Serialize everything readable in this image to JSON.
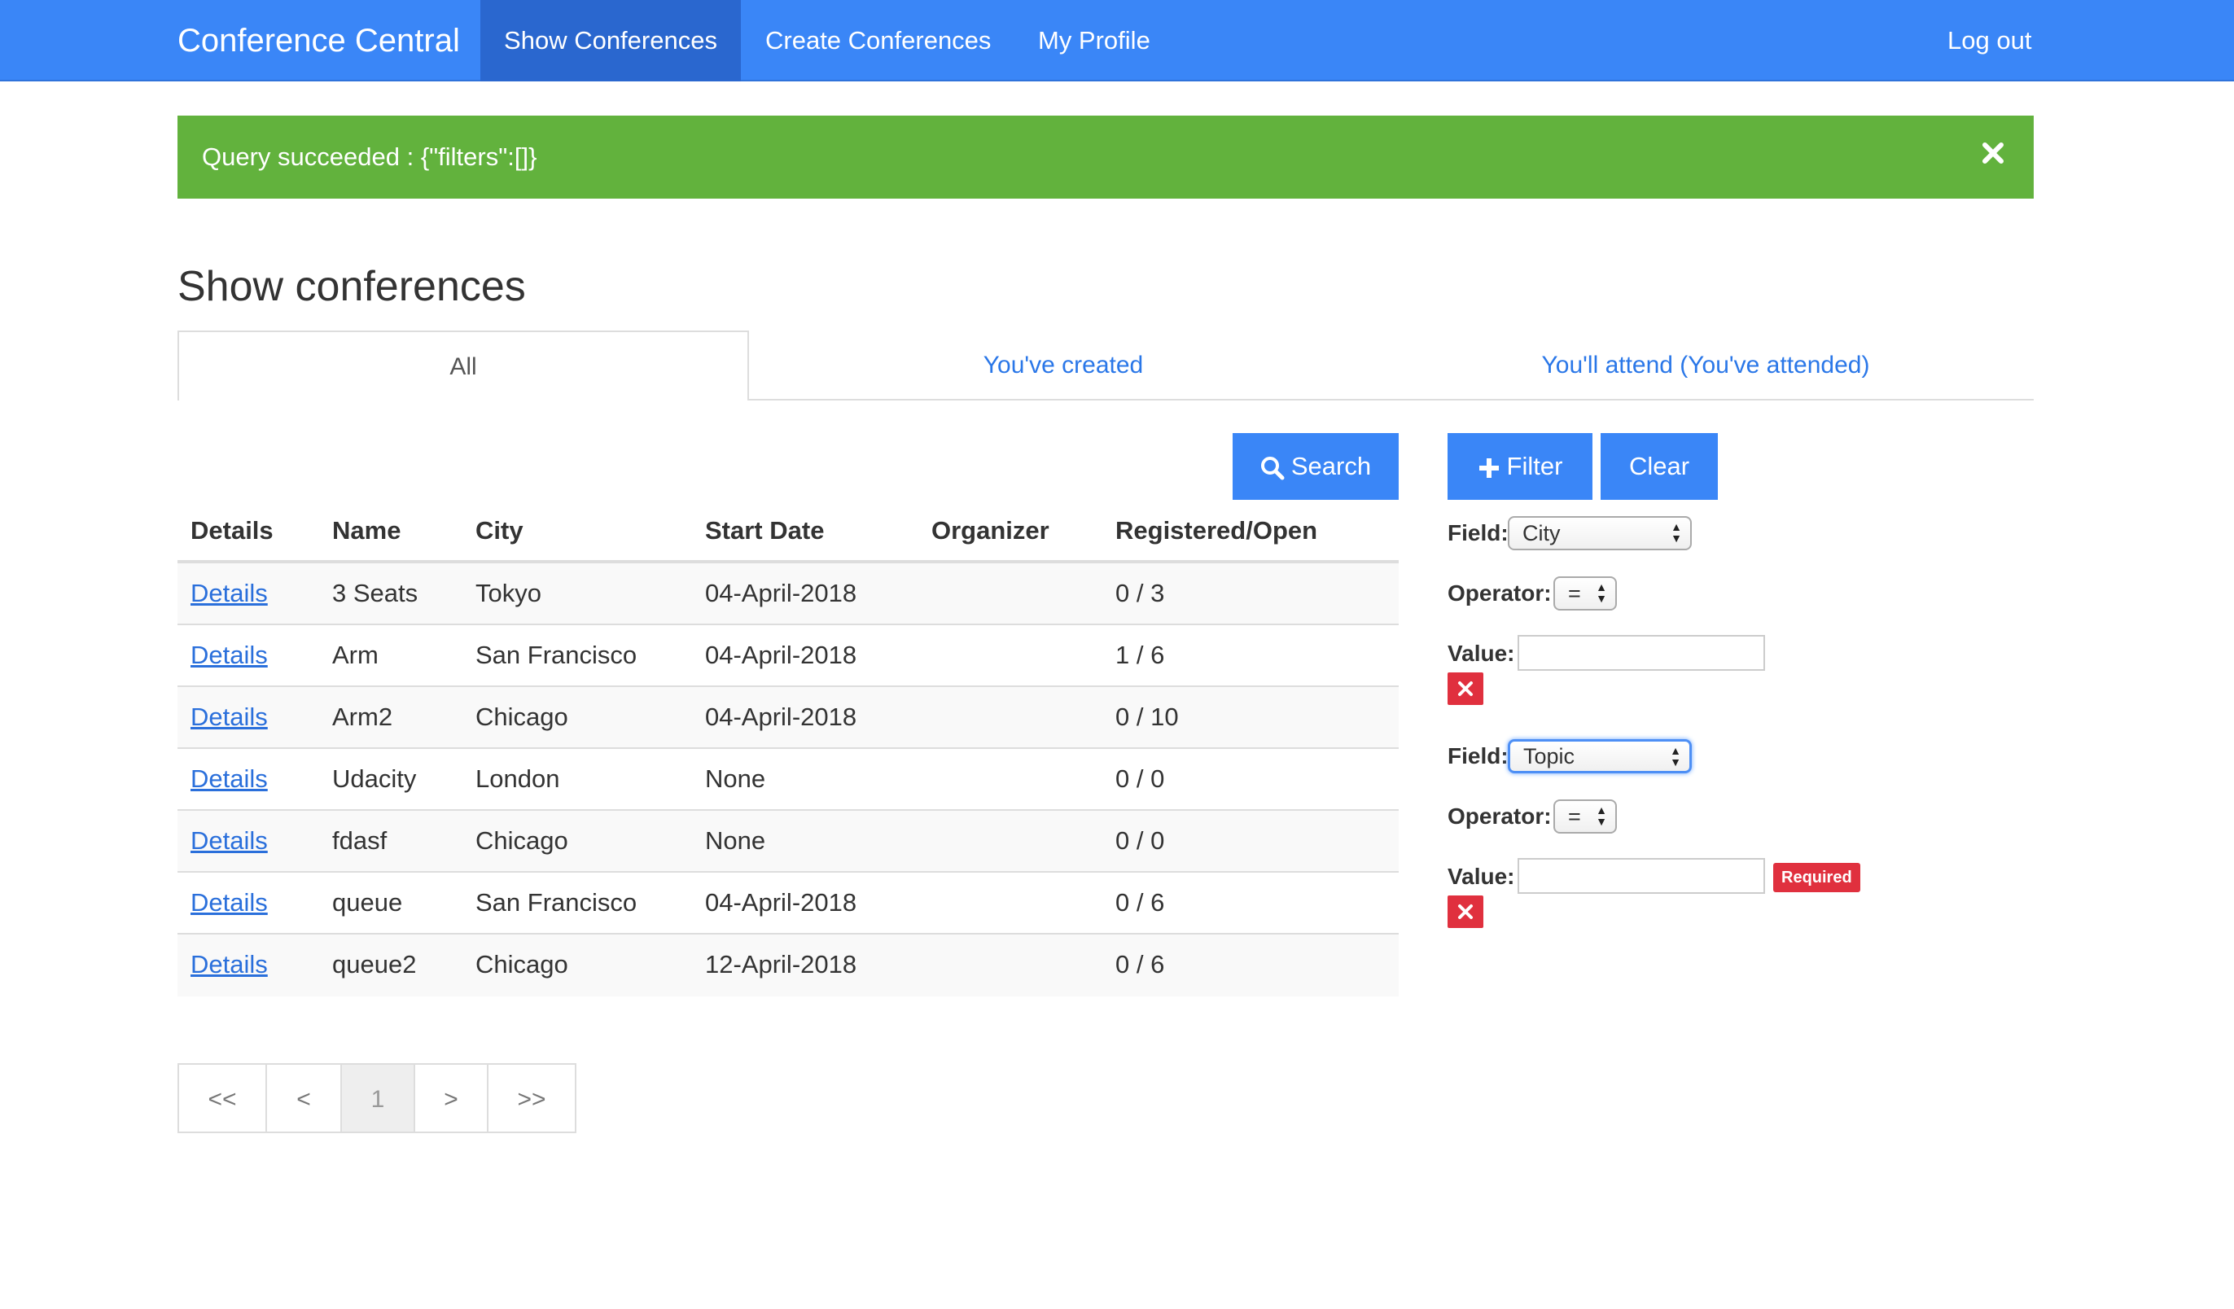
{
  "navbar": {
    "brand": "Conference Central",
    "items": [
      "Show Conferences",
      "Create Conferences",
      "My Profile"
    ],
    "logout": "Log out"
  },
  "alert": {
    "message": "Query succeeded : {\"filters\":[]}"
  },
  "page": {
    "title": "Show conferences"
  },
  "tabs": [
    "All",
    "You've created",
    "You'll attend (You've attended)"
  ],
  "buttons": {
    "search": "Search",
    "filter": "Filter",
    "clear": "Clear"
  },
  "table": {
    "headers": [
      "Details",
      "Name",
      "City",
      "Start Date",
      "Organizer",
      "Registered/Open"
    ],
    "rows": [
      [
        "Details",
        "3 Seats",
        "Tokyo",
        "04-April-2018",
        "",
        "0 / 3"
      ],
      [
        "Details",
        "Arm",
        "San Francisco",
        "04-April-2018",
        "",
        "1 / 6"
      ],
      [
        "Details",
        "Arm2",
        "Chicago",
        "04-April-2018",
        "",
        "0 / 10"
      ],
      [
        "Details",
        "Udacity",
        "London",
        "None",
        "",
        "0 / 0"
      ],
      [
        "Details",
        "fdasf",
        "Chicago",
        "None",
        "",
        "0 / 0"
      ],
      [
        "Details",
        "queue",
        "San Francisco",
        "04-April-2018",
        "",
        "0 / 6"
      ],
      [
        "Details",
        "queue2",
        "Chicago",
        "12-April-2018",
        "",
        "0 / 6"
      ]
    ]
  },
  "pagination": [
    "<<",
    "<",
    "1",
    ">",
    ">>"
  ],
  "filters": {
    "field_label": "Field:",
    "operator_label": "Operator:",
    "value_label": "Value:",
    "items": [
      {
        "field": "City",
        "operator": "=",
        "value": "",
        "required": ""
      },
      {
        "field": "Topic",
        "operator": "=",
        "value": "",
        "required": "Required"
      }
    ]
  },
  "colors": {
    "primary": "#3a86f7",
    "success": "#62b23d",
    "danger": "#e0303e",
    "link": "#2a77e8"
  }
}
